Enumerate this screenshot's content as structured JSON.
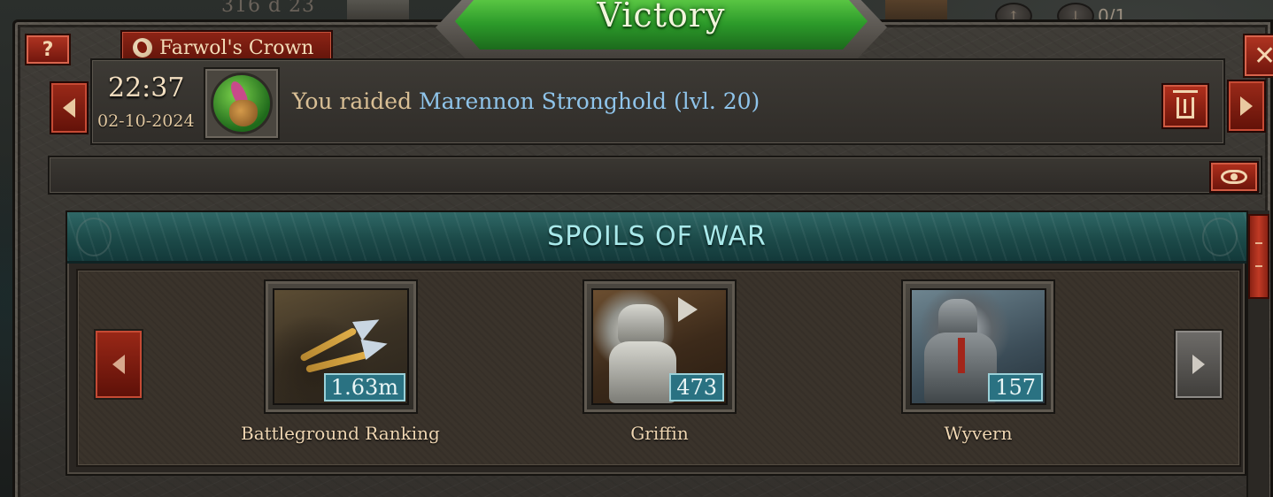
{
  "topbar": {
    "map_text": "316 d 23",
    "counter_text": "0/1"
  },
  "dialog": {
    "banner_title": "Victory",
    "help_label": "?",
    "close_label": "✕",
    "kingdom_name": "Farwol's Crown"
  },
  "report": {
    "time": "22:37",
    "date": "02-10-2024",
    "message_prefix": "You raided",
    "target": "Marennon Stronghold (lvl. 20)",
    "icon": "raid-loot-icon"
  },
  "spoils": {
    "title": "SPOILS OF WAR",
    "items": [
      {
        "name": "Battleground Ranking",
        "quantity": "1.63m",
        "icon": "arrows-icon"
      },
      {
        "name": "Griffin",
        "quantity": "473",
        "icon": "griffin-unit-icon"
      },
      {
        "name": "Wyvern",
        "quantity": "157",
        "icon": "wyvern-unit-icon"
      }
    ]
  },
  "colors": {
    "victory_green": "#2c9a2a",
    "button_red": "#9b2a19",
    "header_teal": "#1c4a49",
    "target_link": "#8fc4ea",
    "quantity_badge": "#2a7282"
  }
}
